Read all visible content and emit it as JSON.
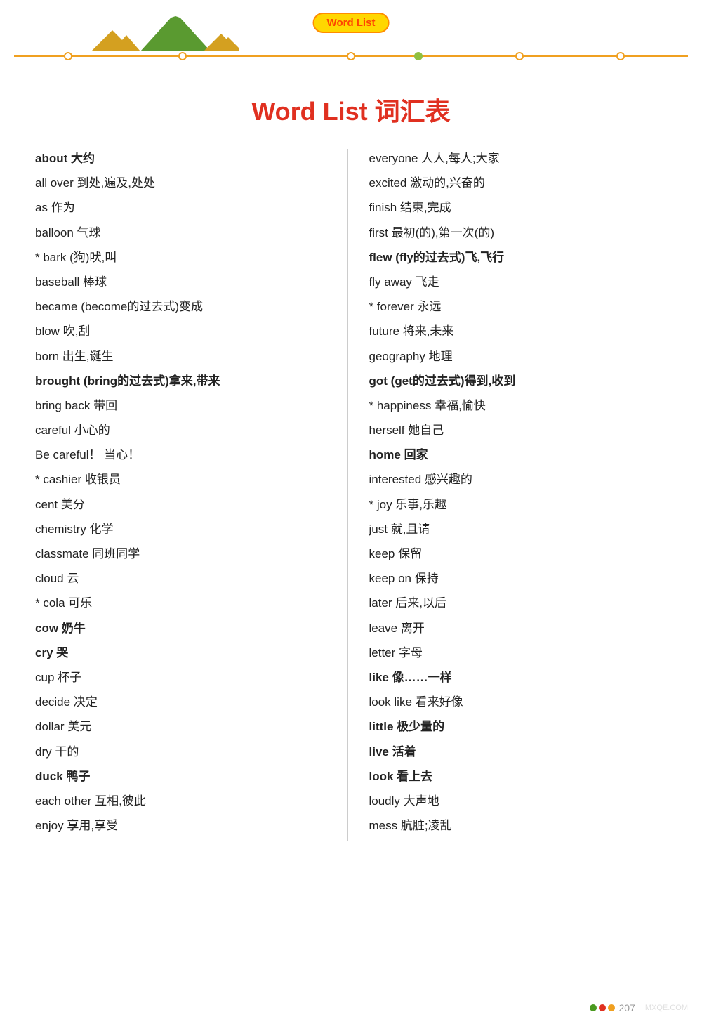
{
  "header": {
    "badge_label": "Word List",
    "title": "Word List 词汇表"
  },
  "timeline": {
    "dots": [
      {
        "pos": "8%",
        "filled": false
      },
      {
        "pos": "25%",
        "filled": false
      },
      {
        "pos": "50%",
        "filled": false
      },
      {
        "pos": "60%",
        "filled": true
      },
      {
        "pos": "75%",
        "filled": false
      },
      {
        "pos": "90%",
        "filled": false
      }
    ]
  },
  "left_column": [
    {
      "en": "about",
      "cn": " 大约",
      "bold": true
    },
    {
      "en": "all over",
      "cn": " 到处,遍及,处处",
      "bold": false
    },
    {
      "en": "as",
      "cn": " 作为",
      "bold": false
    },
    {
      "en": "balloon",
      "cn": " 气球",
      "bold": false
    },
    {
      "en": "* bark",
      "cn": " (狗)吠,叫",
      "bold": false
    },
    {
      "en": "baseball",
      "cn": " 棒球",
      "bold": false
    },
    {
      "en": "became",
      "cn": " (become的过去式)变成",
      "bold": false
    },
    {
      "en": "blow",
      "cn": " 吹,刮",
      "bold": false
    },
    {
      "en": "born",
      "cn": " 出生,诞生",
      "bold": false
    },
    {
      "en": "brought",
      "cn": " (bring的过去式)拿来,带来",
      "bold": true
    },
    {
      "en": "bring back",
      "cn": " 带回",
      "bold": false
    },
    {
      "en": "careful",
      "cn": " 小心的",
      "bold": false
    },
    {
      "en": "Be careful！",
      "cn": " 当心！",
      "bold": false
    },
    {
      "en": "* cashier",
      "cn": " 收银员",
      "bold": false
    },
    {
      "en": "cent",
      "cn": " 美分",
      "bold": false
    },
    {
      "en": "chemistry",
      "cn": " 化学",
      "bold": false
    },
    {
      "en": "classmate",
      "cn": " 同班同学",
      "bold": false
    },
    {
      "en": "cloud",
      "cn": " 云",
      "bold": false
    },
    {
      "en": "* cola",
      "cn": " 可乐",
      "bold": false
    },
    {
      "en": "cow",
      "cn": " 奶牛",
      "bold": true
    },
    {
      "en": "cry",
      "cn": " 哭",
      "bold": true
    },
    {
      "en": "cup",
      "cn": " 杯子",
      "bold": false
    },
    {
      "en": "decide",
      "cn": " 决定",
      "bold": false
    },
    {
      "en": "dollar",
      "cn": " 美元",
      "bold": false
    },
    {
      "en": "dry",
      "cn": " 干的",
      "bold": false
    },
    {
      "en": "duck",
      "cn": " 鸭子",
      "bold": true
    },
    {
      "en": "each other",
      "cn": " 互相,彼此",
      "bold": false
    },
    {
      "en": "enjoy",
      "cn": " 享用,享受",
      "bold": false
    }
  ],
  "right_column": [
    {
      "en": "everyone",
      "cn": " 人人,每人;大家",
      "bold": false
    },
    {
      "en": "excited",
      "cn": " 激动的,兴奋的",
      "bold": false
    },
    {
      "en": "finish",
      "cn": " 结束,完成",
      "bold": false
    },
    {
      "en": "first",
      "cn": " 最初(的),第一次(的)",
      "bold": false
    },
    {
      "en": "flew",
      "cn": " (fly的过去式)飞,飞行",
      "bold": true
    },
    {
      "en": "fly away",
      "cn": " 飞走",
      "bold": false
    },
    {
      "en": "* forever",
      "cn": " 永远",
      "bold": false
    },
    {
      "en": "future",
      "cn": " 将来,未来",
      "bold": false
    },
    {
      "en": "geography",
      "cn": " 地理",
      "bold": false
    },
    {
      "en": "got",
      "cn": " (get的过去式)得到,收到",
      "bold": true
    },
    {
      "en": "* happiness",
      "cn": " 幸福,愉快",
      "bold": false
    },
    {
      "en": "herself",
      "cn": " 她自己",
      "bold": false
    },
    {
      "en": "home",
      "cn": " 回家",
      "bold": true
    },
    {
      "en": "interested",
      "cn": " 感兴趣的",
      "bold": false
    },
    {
      "en": "* joy",
      "cn": " 乐事,乐趣",
      "bold": false
    },
    {
      "en": "just",
      "cn": " 就,且请",
      "bold": false
    },
    {
      "en": "keep",
      "cn": " 保留",
      "bold": false
    },
    {
      "en": "keep on",
      "cn": " 保持",
      "bold": false
    },
    {
      "en": "later",
      "cn": " 后来,以后",
      "bold": false
    },
    {
      "en": "leave",
      "cn": " 离开",
      "bold": false
    },
    {
      "en": "letter",
      "cn": " 字母",
      "bold": false
    },
    {
      "en": "like",
      "cn": " 像……一样",
      "bold": true
    },
    {
      "en": "look like",
      "cn": " 看来好像",
      "bold": false
    },
    {
      "en": "little",
      "cn": " 极少量的",
      "bold": true
    },
    {
      "en": "live",
      "cn": " 活着",
      "bold": true
    },
    {
      "en": "look",
      "cn": " 看上去",
      "bold": true
    },
    {
      "en": "loudly",
      "cn": " 大声地",
      "bold": false
    },
    {
      "en": "mess",
      "cn": " 肮脏;凌乱",
      "bold": false
    }
  ],
  "footer": {
    "page_number": "207",
    "watermark": "MXQE.COM"
  }
}
